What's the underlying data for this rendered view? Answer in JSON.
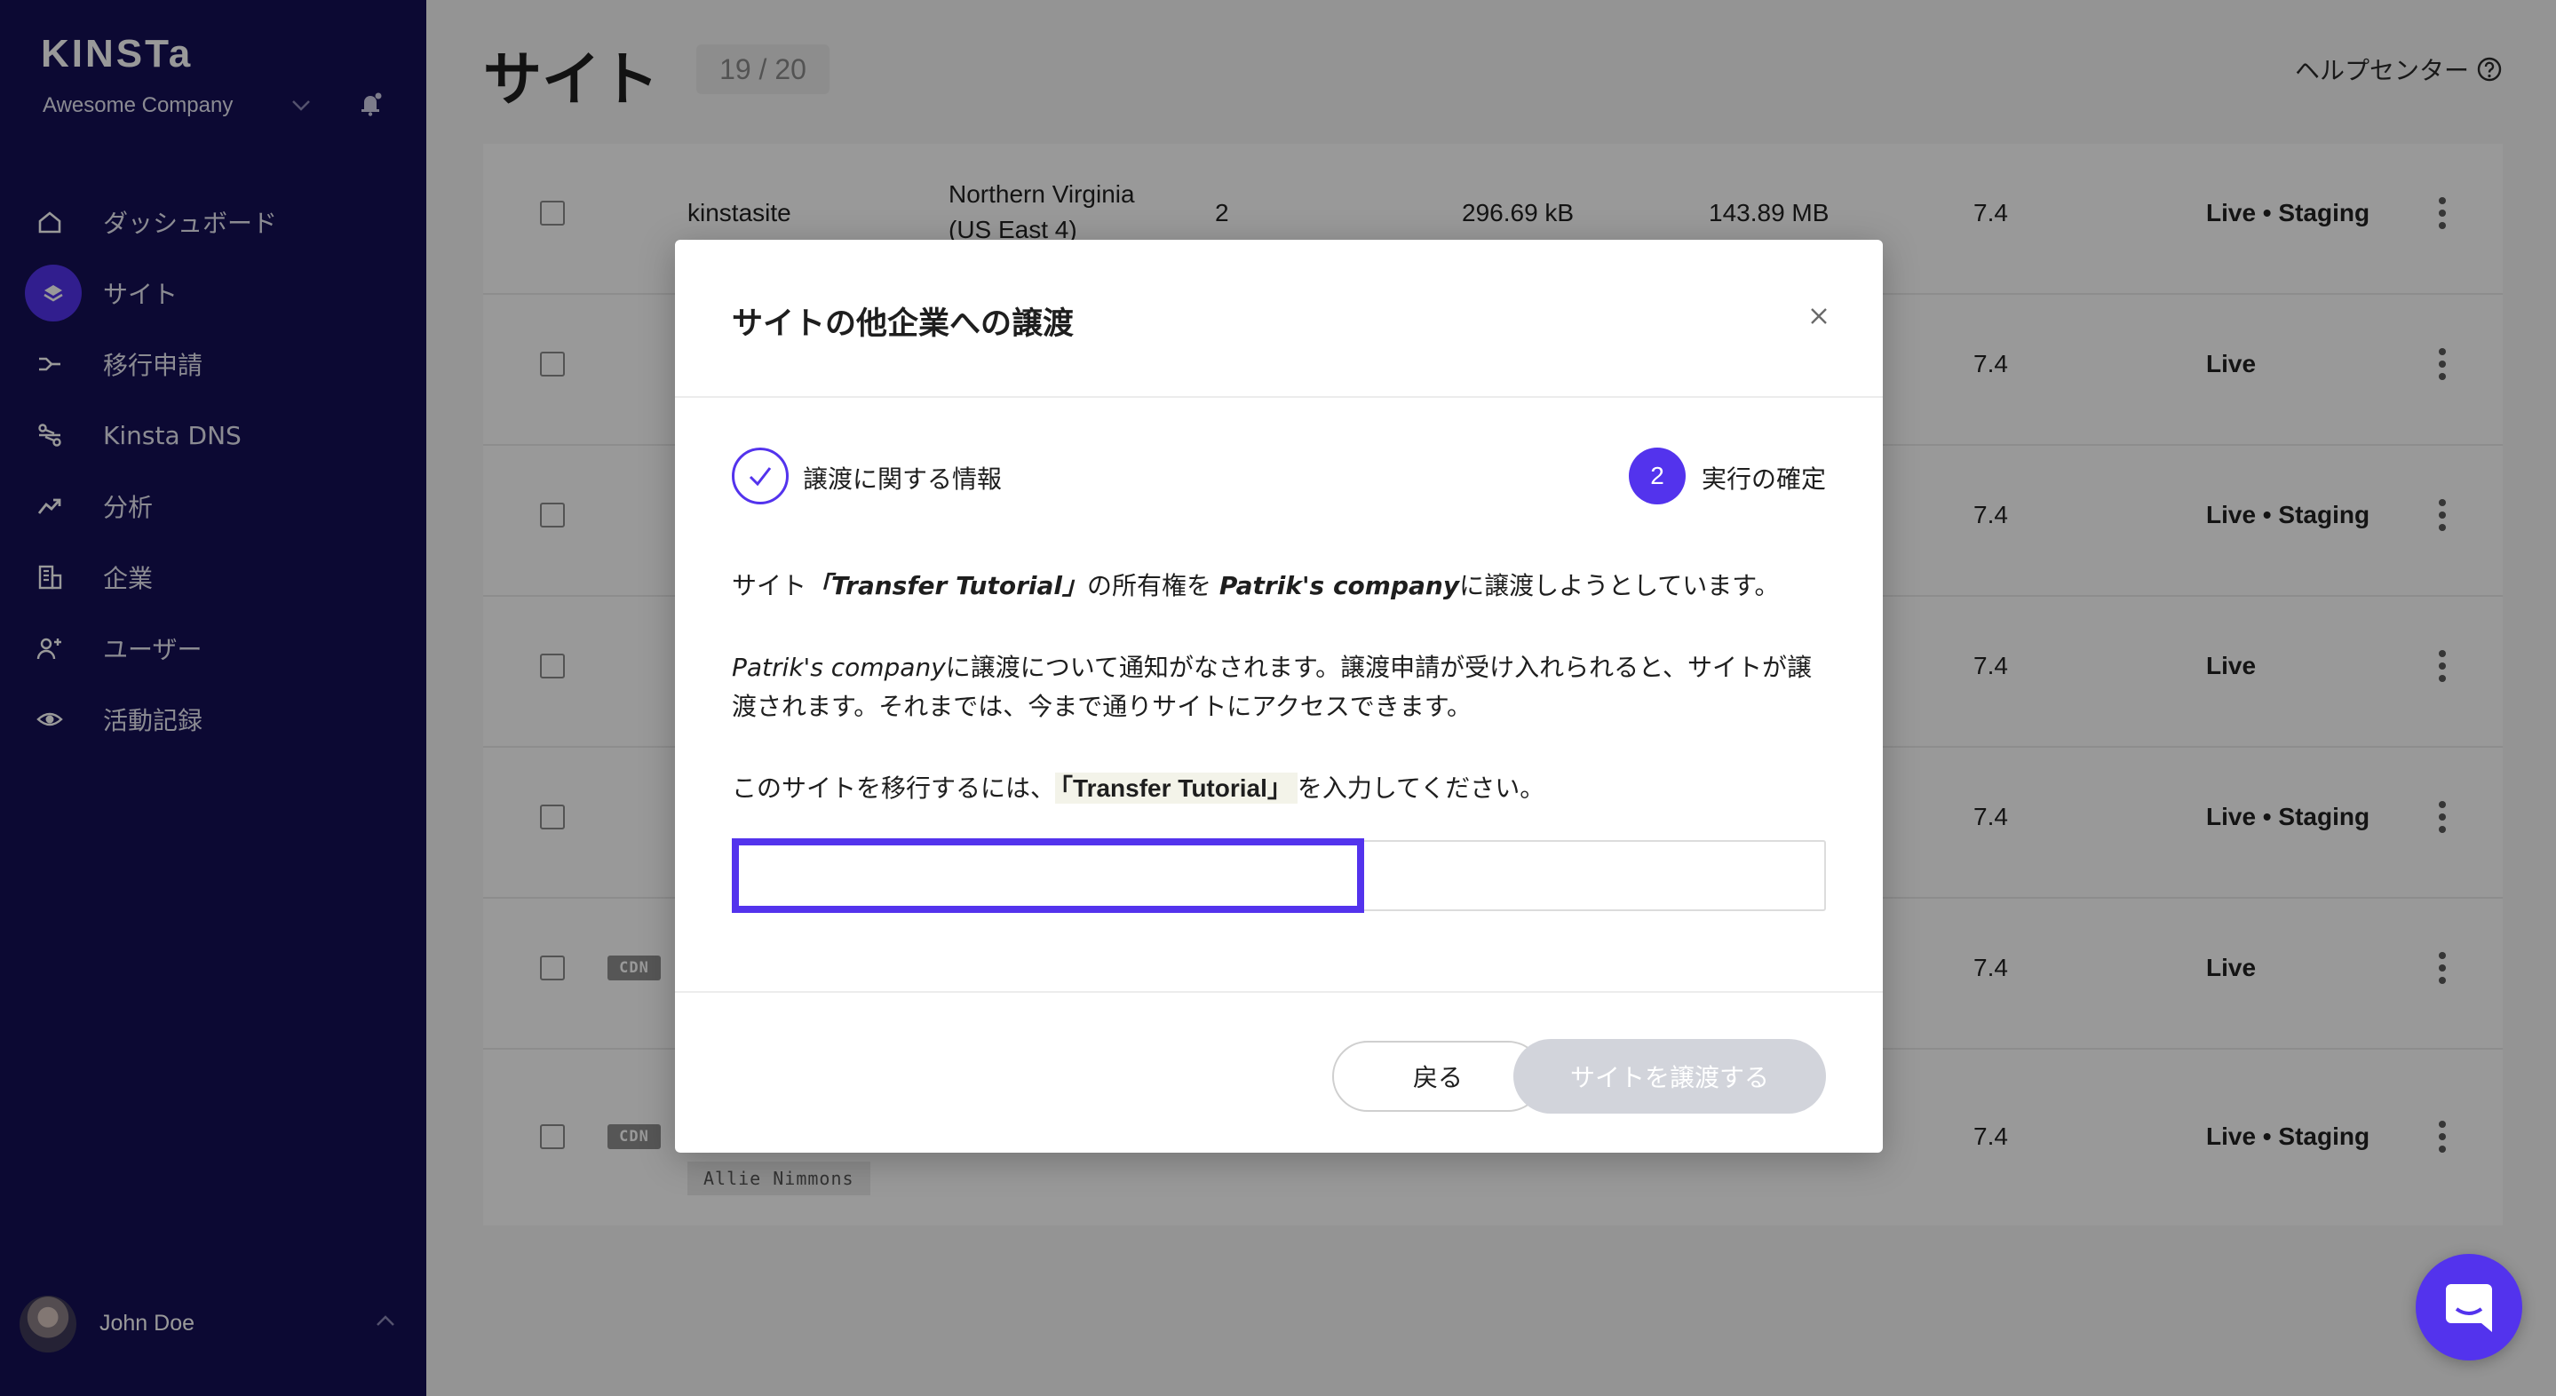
{
  "sidebar": {
    "logo": "KINSTa",
    "company": "Awesome Company",
    "items": [
      {
        "label": "ダッシュボード",
        "icon": "home-icon"
      },
      {
        "label": "サイト",
        "icon": "layers-icon",
        "active": true
      },
      {
        "label": "移行申請",
        "icon": "migration-icon"
      },
      {
        "label": "Kinsta DNS",
        "icon": "dns-icon"
      },
      {
        "label": "分析",
        "icon": "analytics-icon"
      },
      {
        "label": "企業",
        "icon": "building-icon"
      },
      {
        "label": "ユーザー",
        "icon": "add-user-icon"
      },
      {
        "label": "活動記録",
        "icon": "eye-icon"
      }
    ],
    "user": {
      "name": "John Doe"
    }
  },
  "header": {
    "title": "サイト",
    "count": "19 / 20",
    "help": "ヘルプセンター"
  },
  "table": {
    "rows": [
      {
        "name": "kinstasite",
        "location": "Northern Virginia",
        "location_sub": "(US East 4)",
        "visits": "2",
        "bandwidth": "296.69 kB",
        "disk": "143.89 MB",
        "php": "7.4",
        "env": "Live • Staging",
        "cdn": false
      },
      {
        "php": "7.4",
        "env": "Live",
        "cdn": false
      },
      {
        "php": "7.4",
        "env": "Live • Staging",
        "cdn": false
      },
      {
        "php": "7.4",
        "env": "Live",
        "cdn": false
      },
      {
        "php": "7.4",
        "env": "Live • Staging",
        "cdn": false
      },
      {
        "php": "7.4",
        "env": "Live",
        "cdn": true
      },
      {
        "php": "7.4",
        "env": "Live • Staging",
        "cdn": true
      }
    ],
    "cdn_label": "CDN",
    "owner_tag": "Allie Nimmons"
  },
  "modal": {
    "title": "サイトの他企業への譲渡",
    "step1_label": "譲渡に関する情報",
    "step2_number": "2",
    "step2_label": "実行の確定",
    "p1_prefix": "サイト",
    "p1_site": "「Transfer Tutorial」",
    "p1_mid": "の所有権を ",
    "p1_company": "Patrik's company",
    "p1_suffix": "に譲渡しようとしています。",
    "p2_company": "Patrik's company",
    "p2_text": "に譲渡について通知がなされます。譲渡申請が受け入れられると、サイトが譲渡されます。それまでは、今まで通りサイトにアクセスできます。",
    "p3_prefix": "このサイトを移行するには、",
    "p3_code": "「Transfer Tutorial」",
    "p3_suffix": "を入力してください。",
    "input_value": "",
    "back_label": "戻る",
    "transfer_label": "サイトを譲渡する"
  },
  "colors": {
    "sidebar_bg": "#140f55",
    "accent": "#5333ed",
    "disabled_button": "#d2d4db"
  }
}
